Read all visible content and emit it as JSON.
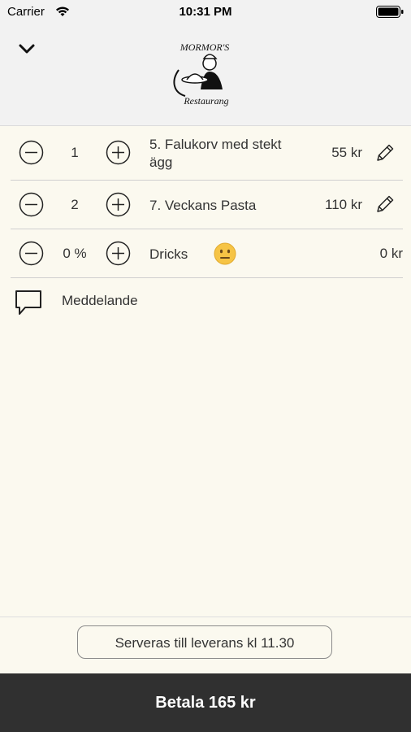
{
  "status_bar": {
    "carrier": "Carrier",
    "time": "10:31 PM"
  },
  "header": {
    "logo_text_top": "MORMOR'S",
    "logo_text_bottom": "Restaurang"
  },
  "order": {
    "items": [
      {
        "qty": "1",
        "name": "5. Falukorv med stekt ägg",
        "price": "55 kr"
      },
      {
        "qty": "2",
        "name": "7. Veckans Pasta",
        "price": "110 kr"
      }
    ],
    "tip": {
      "value": "0 %",
      "label": "Dricks",
      "price": "0 kr"
    },
    "message_label": "Meddelande"
  },
  "footer": {
    "serve_label": "Serveras till leverans kl 11.30",
    "pay_label": "Betala 165 kr"
  },
  "colors": {
    "background": "#fbf9ef",
    "header": "#f2f2f2",
    "pay_bar": "#303030"
  }
}
